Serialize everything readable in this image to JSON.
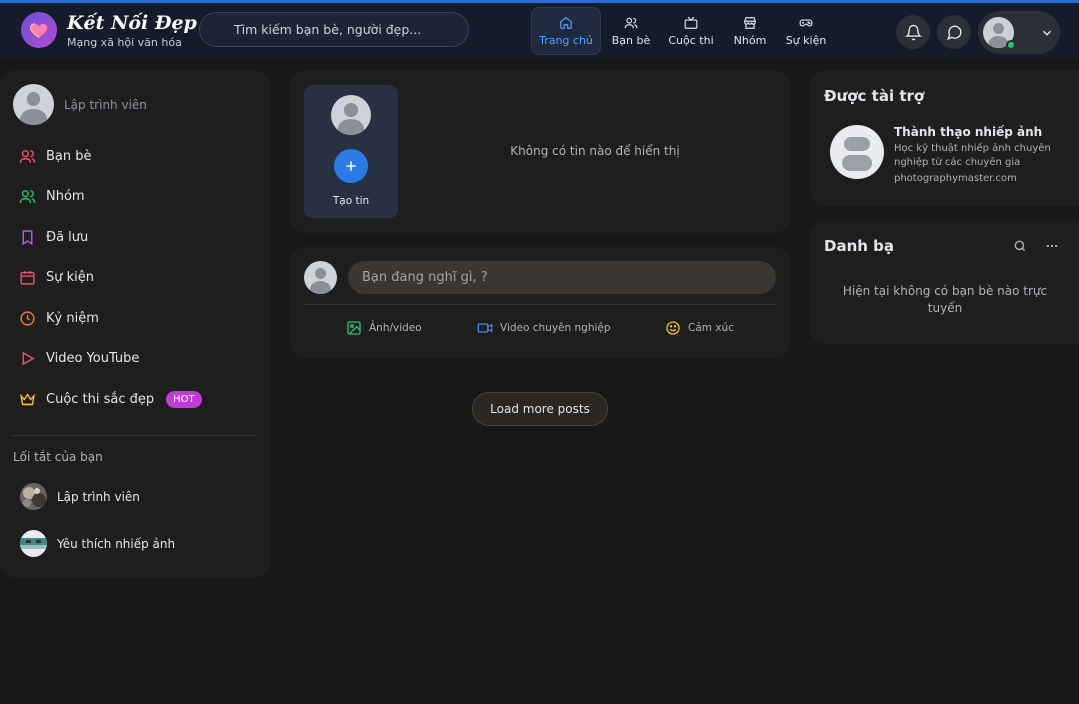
{
  "header": {
    "brand_title": "Kết Nối Đẹp",
    "brand_subtitle": "Mạng xã hội văn hóa",
    "logo_icon": "heart-icon",
    "search_placeholder": "Tìm kiếm bạn bè, người đẹp...",
    "nav": [
      {
        "label": "Trang chủ",
        "icon": "home-icon",
        "active": true
      },
      {
        "label": "Bạn bè",
        "icon": "users-icon",
        "active": false
      },
      {
        "label": "Cuộc thi",
        "icon": "tv-icon",
        "active": false
      },
      {
        "label": "Nhóm",
        "icon": "store-icon",
        "active": false
      },
      {
        "label": "Sự kiện",
        "icon": "gamepad-icon",
        "active": false
      }
    ],
    "accent_color": "#5aa1ff",
    "online_color": "#31c35e"
  },
  "left_sidebar": {
    "user_name": "Lập trình viên",
    "menu": [
      {
        "label": "Bạn bè",
        "icon": "users-icon",
        "color": "#f0506e"
      },
      {
        "label": "Nhóm",
        "icon": "group-icon",
        "color": "#2fbf71"
      },
      {
        "label": "Đã lưu",
        "icon": "bookmark-icon",
        "color": "#b65cf0"
      },
      {
        "label": "Sự kiện",
        "icon": "calendar-icon",
        "color": "#f0506e"
      },
      {
        "label": "Kỷ niệm",
        "icon": "clock-icon",
        "color": "#f07a3a"
      },
      {
        "label": "Video YouTube",
        "icon": "play-icon",
        "color": "#f0506e"
      },
      {
        "label": "Cuộc thi sắc đẹp",
        "icon": "crown-icon",
        "color": "#f2c230",
        "badge": "HOT"
      }
    ],
    "shortcuts_title": "Lối tắt của bạn",
    "shortcuts": [
      {
        "label": "Lập trình viên"
      },
      {
        "label": "Yêu thích nhiếp ảnh"
      }
    ]
  },
  "stories": {
    "create_label": "Tạo tin",
    "empty_text": "Không có tin nào để hiển thị"
  },
  "composer": {
    "placeholder": "Bạn đang nghĩ gì, ?",
    "actions": [
      {
        "label": "Ảnh/video",
        "icon": "image-icon",
        "color": "#2fbf71"
      },
      {
        "label": "Video chuyên nghiệp",
        "icon": "video-icon",
        "color": "#3d8bf2"
      },
      {
        "label": "Cảm xúc",
        "icon": "smile-icon",
        "color": "#f2c230"
      }
    ]
  },
  "feed": {
    "load_more_label": "Load more posts"
  },
  "sponsored": {
    "title": "Được tài trợ",
    "name": "Thành thạo nhiếp ảnh",
    "description": "Học kỹ thuật nhiếp ảnh chuyên nghiệp từ các chuyên gia",
    "url": "photographymaster.com"
  },
  "contacts": {
    "title": "Danh bạ",
    "empty_text": "Hiện tại không có bạn bè nào trực tuyến"
  }
}
